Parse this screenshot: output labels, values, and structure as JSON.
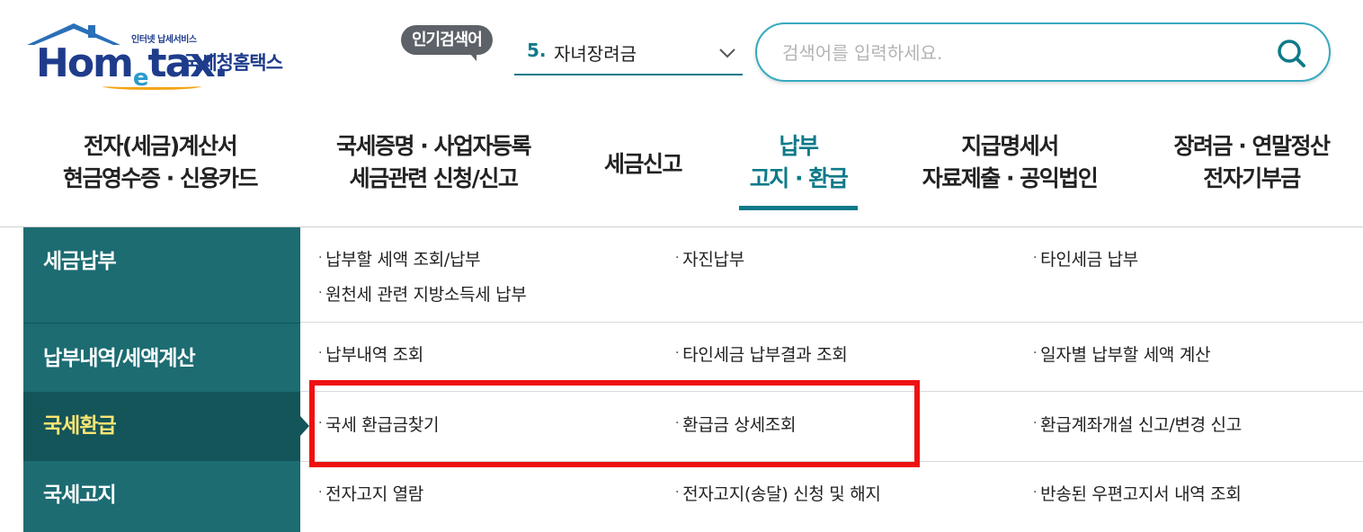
{
  "logo": {
    "sub": "인터넷 납세서비스",
    "brand_pre": "Hom",
    "brand_e": "e",
    "brand_post": "tax.",
    "korean": "국세청홈택스"
  },
  "popular": {
    "badge": "인기검색어",
    "rank": "5.",
    "term": "자녀장려금"
  },
  "search": {
    "placeholder": "검색어를 입력하세요."
  },
  "nav": {
    "items": [
      {
        "line1": "전자(세금)계산서",
        "line2": "현금영수증 · 신용카드"
      },
      {
        "line1": "국세증명 · 사업자등록",
        "line2": "세금관련 신청/신고"
      },
      {
        "line1": "세금신고",
        "line2": ""
      },
      {
        "line1": "납부",
        "line2": "고지 · 환급"
      },
      {
        "line1": "지급명세서",
        "line2": "자료제출 · 공익법인"
      },
      {
        "line1": "장려금 · 연말정산",
        "line2": "전자기부금"
      }
    ],
    "active_index": 3
  },
  "side_menu": [
    {
      "label": "세금납부"
    },
    {
      "label": "납부내역/세액계산"
    },
    {
      "label": "국세환급"
    },
    {
      "label": "국세고지"
    }
  ],
  "sections": [
    {
      "links": [
        "납부할 세액 조회/납부",
        "자진납부",
        "타인세금 납부",
        "원천세 관련 지방소득세 납부"
      ]
    },
    {
      "links": [
        "납부내역 조회",
        "타인세금 납부결과 조회",
        "일자별 납부할 세액 계산"
      ]
    },
    {
      "links": [
        "국세 환급금찾기",
        "환급금 상세조회",
        "환급계좌개설 신고/변경 신고"
      ]
    },
    {
      "links": [
        "전자고지 열람",
        "전자고지(송달) 신청 및 해지",
        "반송된 우편고지서 내역 조회"
      ]
    }
  ],
  "bullet": "·",
  "colors": {
    "brand_navy": "#1f3c8c",
    "accent_teal": "#0e7a89",
    "side_bg": "#1c6c72",
    "side_active_bg": "#145559",
    "side_active_text": "#fde574",
    "highlight_red": "#ee1111"
  }
}
